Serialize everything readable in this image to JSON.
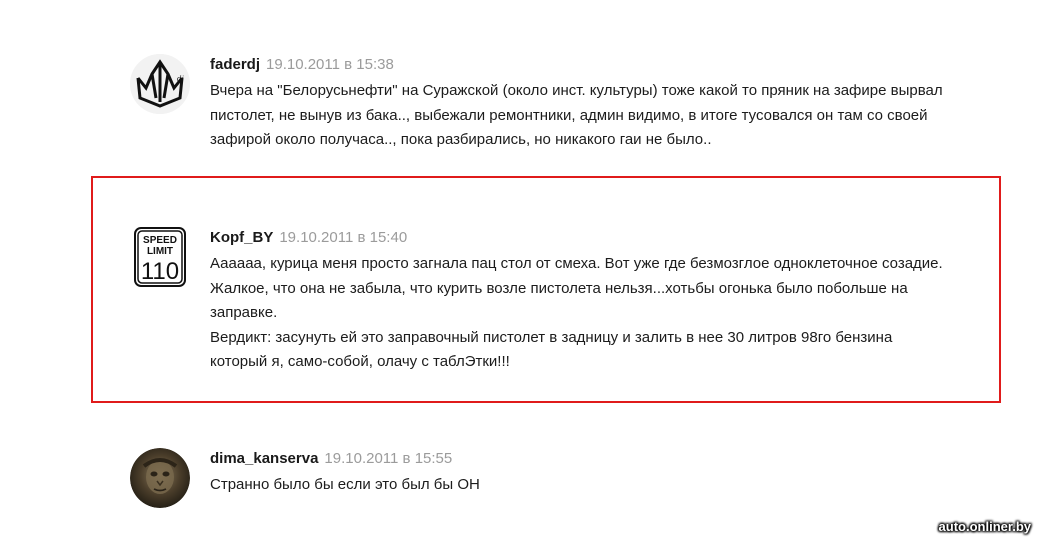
{
  "comments": [
    {
      "author": "faderdj",
      "date": "19.10.2011",
      "sep": "в",
      "time": "15:38",
      "avatar_icon": "trident-logo-icon",
      "paragraphs": [
        "Вчера на \"Белорусьнефти\" на Суражской (около инст. культуры) тоже какой то пряник на зафире вырвал",
        "пистолет, не вынув из бака.., выбежали ремонтники, админ видимо, в итоге тусовался он там со своей",
        "зафирой около получаса.., пока разбирались, но никакого гаи не было.."
      ]
    },
    {
      "author": "Kopf_BY",
      "date": "19.10.2011",
      "sep": "в",
      "time": "15:40",
      "avatar_icon": "speed-limit-sign-icon",
      "avatar_sign_top": "SPEED",
      "avatar_sign_mid": "LIMIT",
      "avatar_sign_num": "110",
      "paragraphs": [
        "Аааааа, курица меня просто загнала пац стол от смеха. Вот уже где безмозглое одноклеточное созадие.",
        "Жалкое, что она не забыла, что курить возле пистолета нельзя...хотьбы огонька было побольше на",
        "заправке.",
        "Вердикт: засунуть ей это заправочный пистолет в задницу и залить в нее 30 литров 98го бензина",
        "который я, само-собой, олачу с таблЭтки!!!"
      ]
    },
    {
      "author": "dima_kanserva",
      "date": "19.10.2011",
      "sep": "в",
      "time": "15:55",
      "avatar_icon": "user-photo-icon",
      "paragraphs": [
        "Странно было бы если это был бы ОН"
      ]
    }
  ],
  "highlight_color": "#e01b1b",
  "watermark": "auto.onliner.by"
}
